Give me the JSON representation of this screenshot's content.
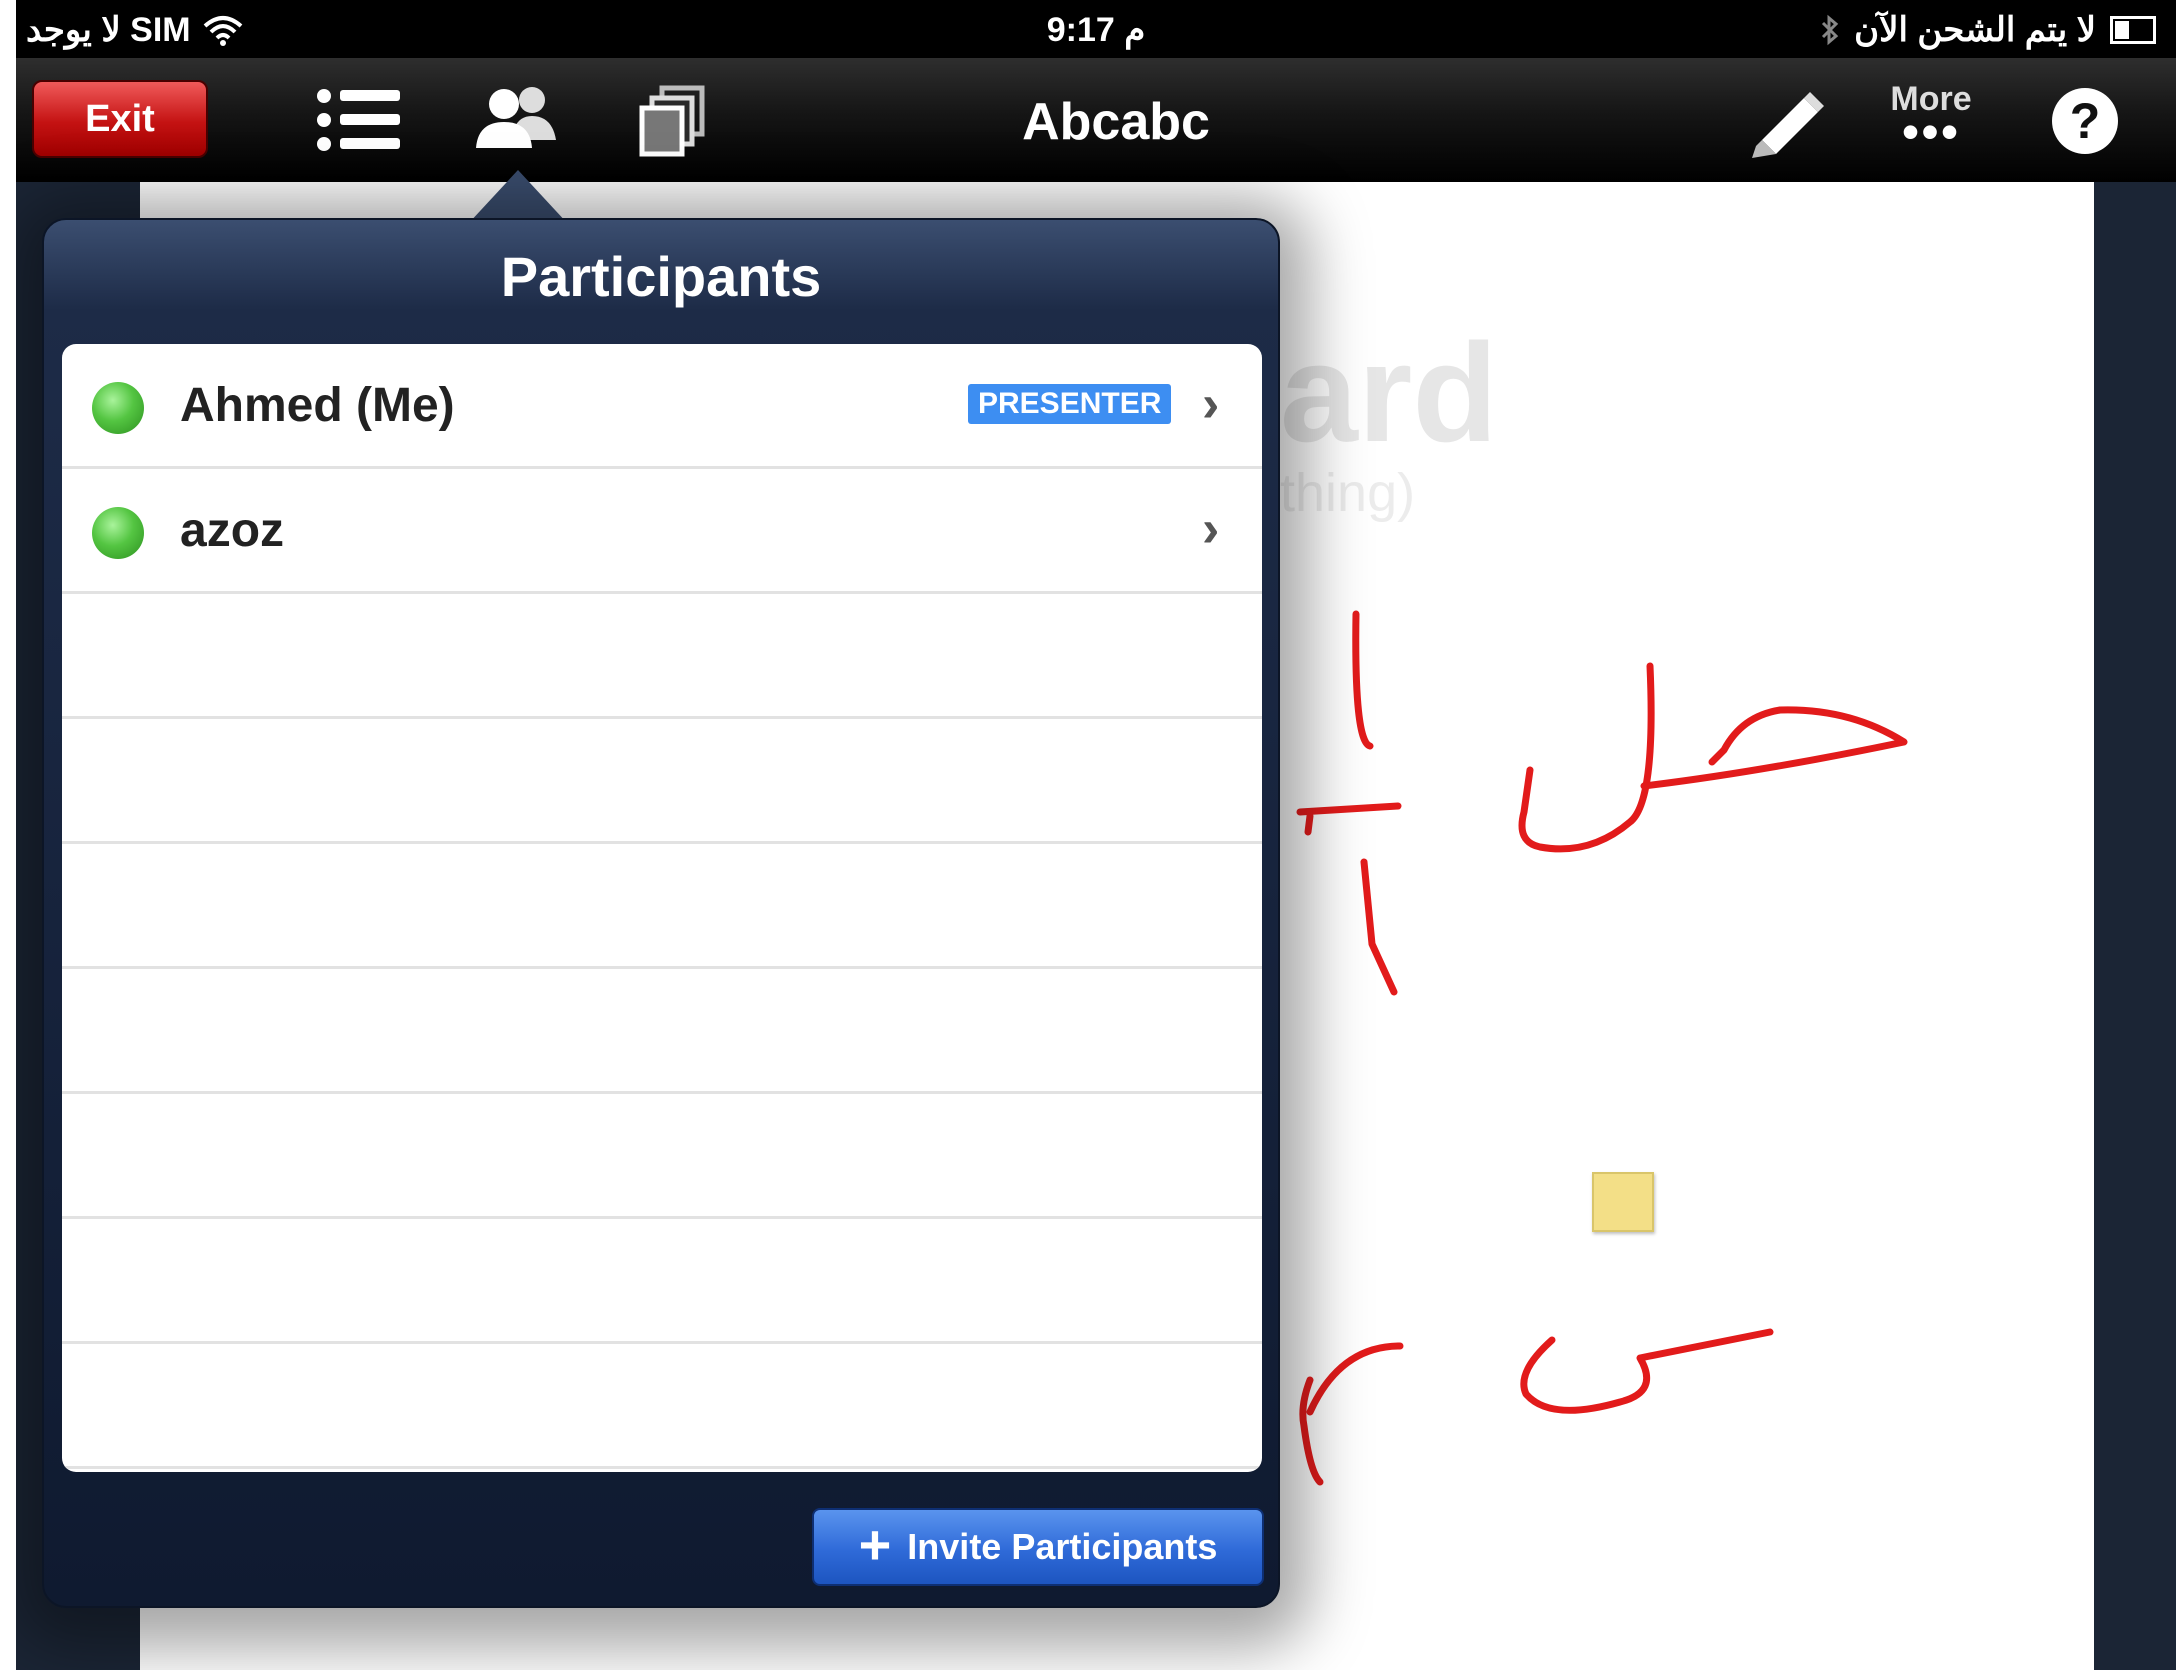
{
  "status_bar": {
    "carrier": "لا يوجد SIM",
    "time": "9:17 م",
    "charging": "لا يتم الشحن الآن"
  },
  "toolbar": {
    "exit_label": "Exit",
    "title": "Abcabc",
    "more_label": "More",
    "more_dots": "•••",
    "help_label": "?"
  },
  "popover": {
    "title": "Participants",
    "participants": [
      {
        "name": "Ahmed (Me)",
        "badge": "PRESENTER",
        "status": "online"
      },
      {
        "name": "azoz",
        "badge": "",
        "status": "online"
      }
    ],
    "invite_label": "Invite Participants",
    "invite_icon": "+"
  },
  "whiteboard": {
    "ghost_title": "ard",
    "ghost_subtitle": "thing)"
  },
  "colors": {
    "exit_red": "#c41212",
    "presenter_badge": "#3d8ef2",
    "invite_blue": "#2f6ad8",
    "ink_red": "#e21b1b",
    "online_green": "#54c542",
    "sticky_yellow": "#f3df87"
  }
}
